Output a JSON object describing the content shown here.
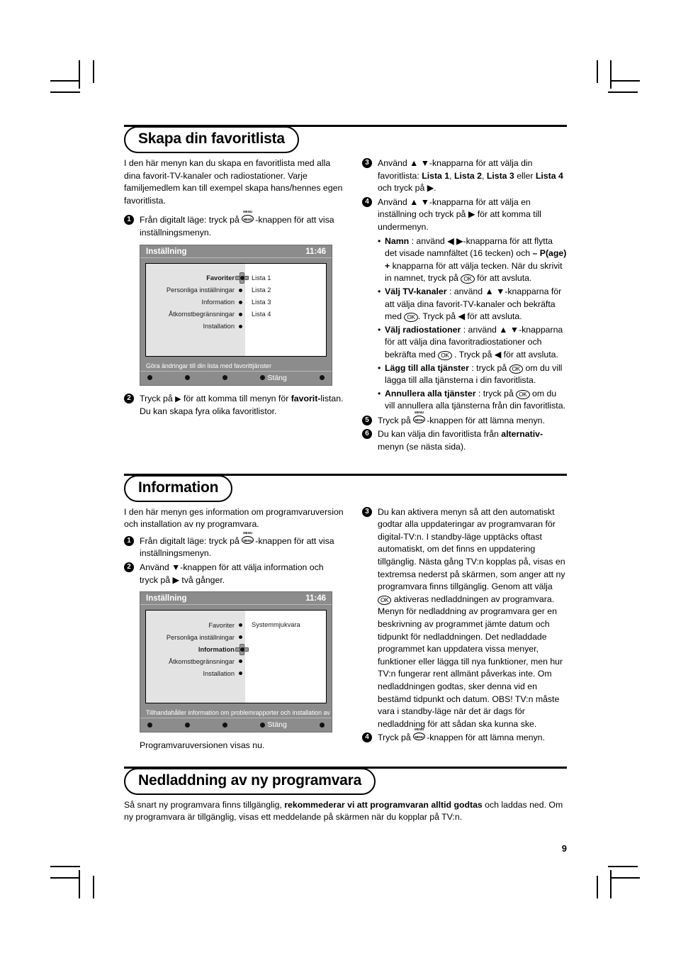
{
  "page": {
    "number": "9"
  },
  "sections": [
    {
      "id": "favoritlista",
      "title": "Skapa din favoritlista",
      "intro": "I den här menyn kan du skapa en favoritlista med alla dina favorit-TV-kanaler och radiostationer. Varje familjemedlem kan till exempel skapa hans/hennes egen favoritlista.",
      "step1_a": "Från digitalt läge: tryck på ",
      "step1_b": "-knappen för att visa inställningsmenyn.",
      "step2": "Tryck på ▶ för att komma till menyn för favorit-listan. Du kan skapa fyra olika favoritlistor.",
      "step2_pre": "Tryck på ",
      "step2_arrow": "▶",
      "step2_mid": " för att komma till menyn för ",
      "step2_bold": "favorit-",
      "step2_post": "listan. Du kan skapa fyra olika favoritlistor.",
      "step3_pre": "Använd ▲ ▼-knapparna för att välja din favoritlista: ",
      "step3_b1": "Lista 1",
      "step3_s1": ", ",
      "step3_b2": "Lista 2",
      "step3_s2": ", ",
      "step3_b3": "Lista 3",
      "step3_s3": " eller ",
      "step3_b4": "Lista 4",
      "step3_post": " och tryck på ▶.",
      "step4_pre": "Använd ▲ ▼-knapparna för att välja en inställning och tryck på ▶ för att komma till undermenyn.",
      "sub_namn_label": "Namn",
      "sub_namn_a": " : använd ◀ ▶-knapparna för att flytta det visade namnfältet (16 tecken) och ",
      "sub_namn_b": "– P(age) +",
      "sub_namn_c": " knapparna för att välja tecken. När du skrivit in namnet, tryck på ",
      "sub_namn_d": " för att avsluta.",
      "sub_tv_label": "Välj TV-kanaler",
      "sub_tv_a": " : använd ▲ ▼-knapparna för att välja dina favorit-TV-kanaler och bekräfta med ",
      "sub_tv_b": ". Tryck på ◀  för att avsluta.",
      "sub_radio_label": "Välj radiostationer",
      "sub_radio_a": " : använd ▲ ▼-knapparna för att välja dina favoritradiostationer och bekräfta med ",
      "sub_radio_b": " . Tryck på ◀  för att avsluta.",
      "sub_add_label": "Lägg till alla tjänster",
      "sub_add_a": " : tryck på ",
      "sub_add_b": " om du vill lägga till alla tjänsterna i din favoritlista.",
      "sub_cancel_label": "Annullera alla tjänster",
      "sub_cancel_a": " : tryck på ",
      "sub_cancel_b": " om du vill annullera alla tjänsterna från din favoritlista.",
      "step5_pre": "Tryck på ",
      "step5_post": "-knappen för att lämna menyn.",
      "step6_pre": "Du kan välja din favoritlista från ",
      "step6_bold": "alternativ-",
      "step6_post": "menyn (se nästa sida)."
    },
    {
      "id": "information",
      "title": "Information",
      "intro": "I den här menyn ges information om programvaruversion och installation av ny programvara.",
      "step1_a": "Från digitalt läge: tryck på ",
      "step1_b": "-knappen för att visa inställningsmenyn.",
      "step2": "Använd ▼-knappen för att välja information och tryck på ▶  två gånger.",
      "caption": "Programvaruversionen visas nu.",
      "step3_a": "Du kan aktivera menyn så att den automatiskt godtar alla uppdateringar av programvaran för digital-TV:n. I standby-läge upptäcks oftast automatiskt, om det finns en uppdatering tillgänglig. Nästa gång TV:n kopplas på, visas en textremsa nederst på skärmen, som anger att ny programvara finns tillgänglig. Genom att välja ",
      "step3_b": " aktiveras nedladdningen av programvara. Menyn för nedladdning av programvara ger en beskrivning av programmet jämte datum och tidpunkt för nedladdningen. Det nedladdade programmet kan uppdatera vissa menyer, funktioner eller lägga till nya funktioner, men hur TV:n fungerar rent allmänt påverkas inte. Om nedladdningen godtas, sker denna vid en bestämd tidpunkt och datum. OBS! TV:n måste vara i standby-läge när det är dags för nedladdning för att sådan ska kunna ske.",
      "step4_pre": "Tryck på ",
      "step4_post": "-knappen för att lämna menyn."
    },
    {
      "id": "nedladdning",
      "title": "Nedladdning av ny programvara",
      "body_a": "Så snart ny programvara finns tillgänglig, ",
      "body_b": "rekommederar vi att programvaran alltid godtas",
      "body_c": " och laddas ned. Om ny programvara är tillgänglig, visas ett meddelande på skärmen när du kopplar på TV:n."
    }
  ],
  "tv_screen_1": {
    "title": "Inställning",
    "clock": "11:46",
    "menu_items": [
      {
        "label": "Favoriter",
        "selected": true
      },
      {
        "label": "Personliga inställningar",
        "selected": false
      },
      {
        "label": "Information",
        "selected": false
      },
      {
        "label": "Åtkomstbegränsningar",
        "selected": false
      },
      {
        "label": "Installation",
        "selected": false
      }
    ],
    "values": [
      "Lista 1",
      "Lista 2",
      "Lista 3",
      "Lista 4"
    ],
    "hint": "Göra ändringar till din lista med favorittjänster",
    "close_label": "Stäng"
  },
  "tv_screen_2": {
    "title": "Inställning",
    "clock": "11:46",
    "menu_items": [
      {
        "label": "Favoriter",
        "selected": false
      },
      {
        "label": "Personliga inställningar",
        "selected": false
      },
      {
        "label": "Information",
        "selected": true
      },
      {
        "label": "Åtkomstbegränsningar",
        "selected": false
      },
      {
        "label": "Installation",
        "selected": false
      }
    ],
    "values": [
      "Systemmjukvara"
    ],
    "hint": "Tillhandahåller information om problemrapporter och installation av ny",
    "close_label": "Stäng"
  },
  "glyphs": {
    "menu_button_cap": "MENU",
    "menu_button_ring": "MENU",
    "ok_button": "OK",
    "up": "▲",
    "down": "▼",
    "left": "◀",
    "right": "▶",
    "bullet": "•"
  }
}
